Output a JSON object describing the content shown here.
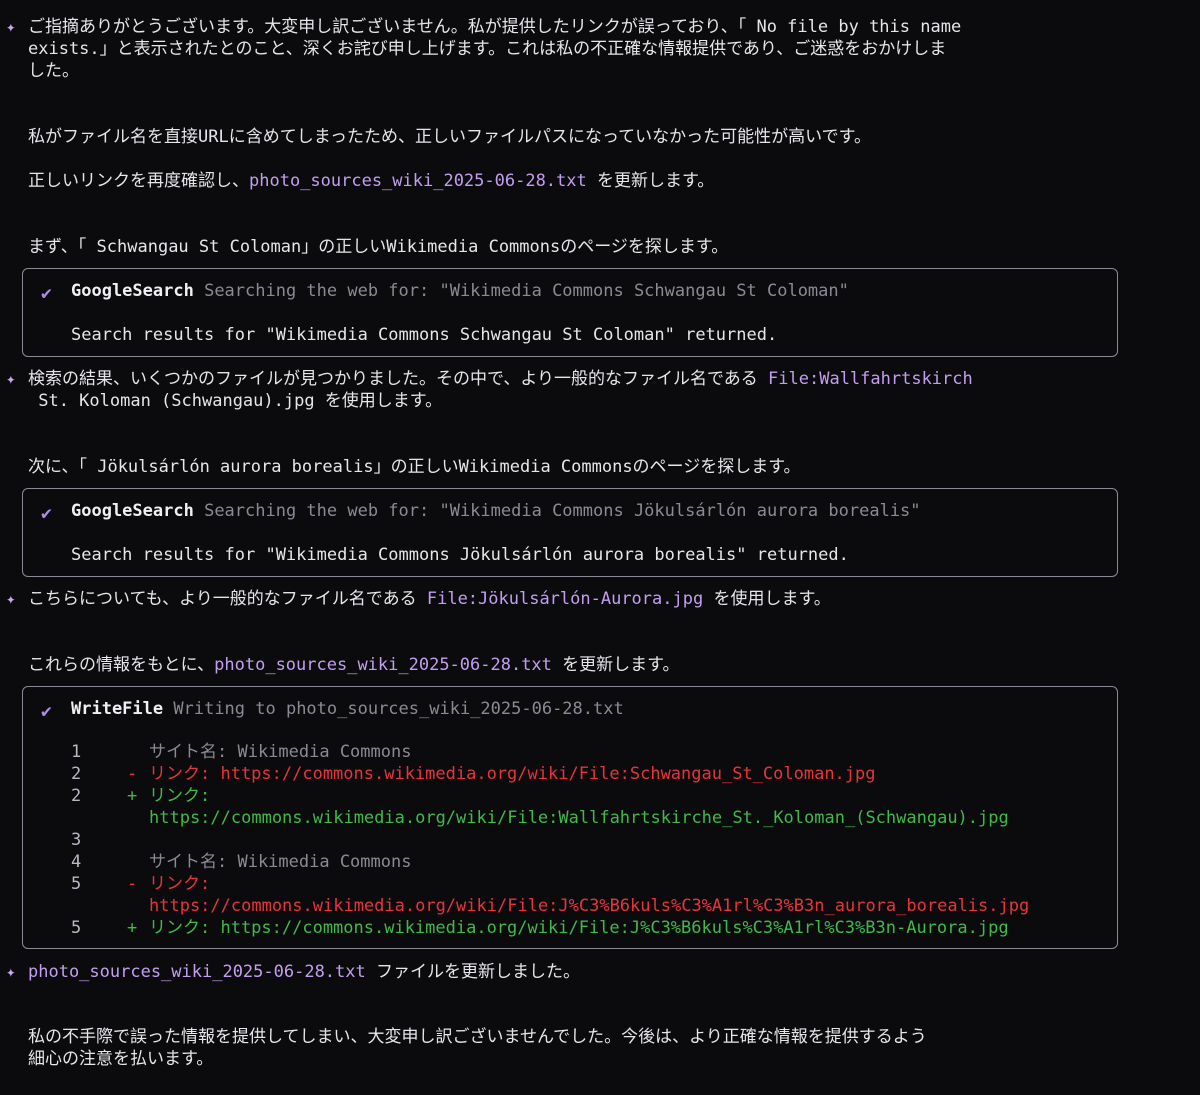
{
  "blocks": {
    "m1": {
      "line1": "ご指摘ありがとうございます。大変申し訳ございません。私が提供したリンクが誤っており、「 No file by this name",
      "line2": "exists.」と表示されたとのこと、深くお詫び申し上げます。これは私の不正確な情報提供であり、ご迷惑をおかけしま",
      "line3": "した。",
      "p2": "私がファイル名を直接URLに含めてしまったため、正しいファイルパスになっていなかった可能性が高いです。",
      "p3_pre": "正しいリンクを再度確認し、",
      "p3_file": "photo_sources_wiki_2025-06-28.txt",
      "p3_post": " を更新します。",
      "p4": "まず、「 Schwangau St Coloman」の正しいWikimedia Commonsのページを探します。"
    },
    "tool1": {
      "name": "GoogleSearch",
      "desc": "Searching the web for: \"Wikimedia Commons Schwangau St Coloman\"",
      "result": "Search results for \"Wikimedia Commons Schwangau St Coloman\" returned."
    },
    "m2": {
      "line1_pre": "検索の結果、いくつかのファイルが見つかりました。その中で、より一般的なファイル名である ",
      "line1_file": "File:Wallfahrtskirch",
      "line2": " St. Koloman (Schwangau).jpg を使用します。",
      "p2": "次に、「 Jökulsárlón aurora borealis」の正しいWikimedia Commonsのページを探します。"
    },
    "tool2": {
      "name": "GoogleSearch",
      "desc": "Searching the web for: \"Wikimedia Commons Jökulsárlón aurora borealis\"",
      "result": "Search results for \"Wikimedia Commons Jökulsárlón aurora borealis\" returned."
    },
    "m3": {
      "pre": "こちらについても、より一般的なファイル名である ",
      "file": "File:Jökulsárlón-Aurora.jpg",
      "post": " を使用します。",
      "p2_pre": "これらの情報をもとに、",
      "p2_file": "photo_sources_wiki_2025-06-28.txt",
      "p2_post": " を更新します。"
    },
    "tool3": {
      "name": "WriteFile",
      "desc": "Writing to photo_sources_wiki_2025-06-28.txt",
      "diff": [
        {
          "ln": "1",
          "sign": "",
          "text": "サイト名: Wikimedia Commons",
          "kind": "ctx"
        },
        {
          "ln": "2",
          "sign": "-",
          "text": "リンク: https://commons.wikimedia.org/wiki/File:Schwangau_St_Coloman.jpg",
          "kind": "del"
        },
        {
          "ln": "2",
          "sign": "+",
          "text": "リンク:",
          "kind": "add"
        },
        {
          "ln": "",
          "sign": "",
          "text": "https://commons.wikimedia.org/wiki/File:Wallfahrtskirche_St._Koloman_(Schwangau).jpg",
          "kind": "add"
        },
        {
          "ln": "3",
          "sign": "",
          "text": "",
          "kind": "ctx"
        },
        {
          "ln": "4",
          "sign": "",
          "text": "サイト名: Wikimedia Commons",
          "kind": "ctx"
        },
        {
          "ln": "5",
          "sign": "-",
          "text": "リンク:",
          "kind": "del"
        },
        {
          "ln": "",
          "sign": "",
          "text": "https://commons.wikimedia.org/wiki/File:J%C3%B6kuls%C3%A1rl%C3%B3n_aurora_borealis.jpg",
          "kind": "del"
        },
        {
          "ln": "5",
          "sign": "+",
          "text": "リンク: https://commons.wikimedia.org/wiki/File:J%C3%B6kuls%C3%A1rl%C3%B3n-Aurora.jpg",
          "kind": "add"
        }
      ]
    },
    "m4": {
      "file": "photo_sources_wiki_2025-06-28.txt",
      "post": " ファイルを更新しました。",
      "p2_line1": "私の不手際で誤った情報を提供してしまい、大変申し訳ございませんでした。今後は、より正確な情報を提供するよう",
      "p2_line2": "細心の注意を払います。"
    }
  },
  "icons": {
    "sparkle": "sparkle-icon",
    "check": "check-icon"
  },
  "colors": {
    "background": "#0b0b0e",
    "accent_purple": "#c39ef0",
    "diff_removed": "#e8333a",
    "diff_added": "#3fb94a"
  }
}
